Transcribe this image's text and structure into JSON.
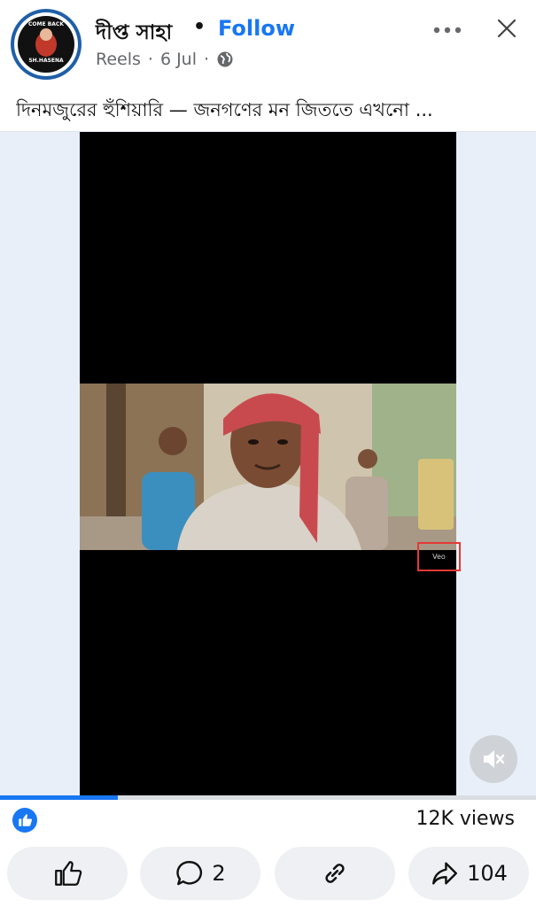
{
  "header": {
    "author_name": "দীপ্ত সাহা",
    "separator": "•",
    "follow_label": "Follow",
    "meta_source": "Reels",
    "meta_dot": "·",
    "meta_date": "6 Jul",
    "meta_dot2": "·",
    "avatar_top_text": "COME BACK",
    "avatar_bottom_text": "SH.HASENA"
  },
  "caption": "দিনমজুরের হুঁশিয়ারি — জনগণের মন জিততে এখনো ...",
  "video": {
    "watermark": "Veo",
    "progress": 0.22
  },
  "stats": {
    "views": "12K views"
  },
  "actions": {
    "comment_count": "2",
    "share_count": "104"
  },
  "colors": {
    "accent": "#1877f2",
    "highlight_box": "#e53935"
  }
}
